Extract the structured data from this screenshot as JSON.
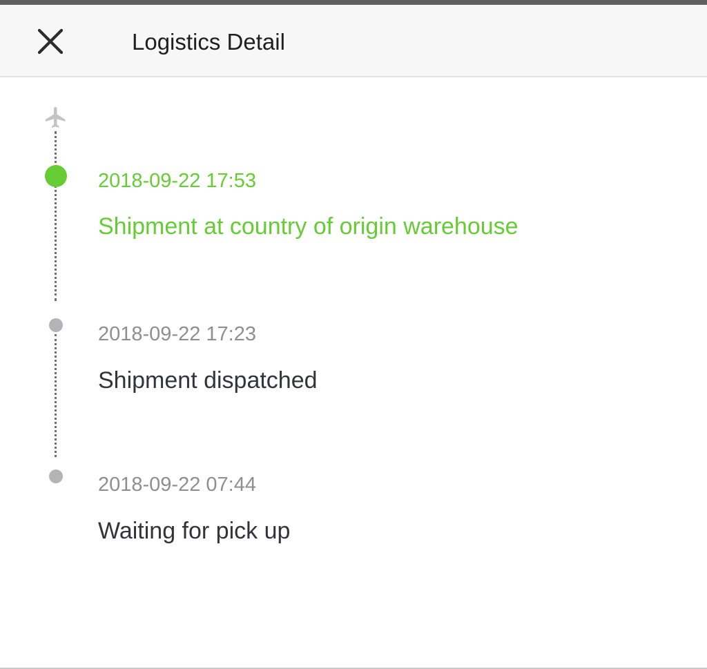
{
  "header": {
    "title": "Logistics Detail",
    "close_icon": "close-icon"
  },
  "timeline": {
    "start_icon": "airplane-icon",
    "events": [
      {
        "time": "2018-09-22 17:53",
        "description": "Shipment at country of origin warehouse",
        "active": true
      },
      {
        "time": "2018-09-22 17:23",
        "description": "Shipment dispatched",
        "active": false
      },
      {
        "time": "2018-09-22 07:44",
        "description": "Waiting for pick up",
        "active": false
      }
    ]
  },
  "colors": {
    "active": "#66cc33",
    "inactive_dot": "#b4b4b8",
    "time_text": "#8e8e93",
    "description_text": "#33343b",
    "header_bg": "#f7f7f7"
  }
}
